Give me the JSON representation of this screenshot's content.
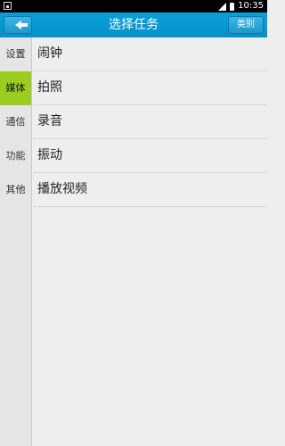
{
  "status_bar": {
    "time": "10:35"
  },
  "header": {
    "title": "选择任务",
    "category_label": "类别"
  },
  "sidebar": {
    "items": [
      {
        "label": "设置",
        "active": false
      },
      {
        "label": "媒体",
        "active": true
      },
      {
        "label": "通信",
        "active": false
      },
      {
        "label": "功能",
        "active": false
      },
      {
        "label": "其他",
        "active": false
      }
    ]
  },
  "tasks": [
    {
      "label": "闹钟"
    },
    {
      "label": "拍照"
    },
    {
      "label": "录音"
    },
    {
      "label": "振动"
    },
    {
      "label": "播放视频"
    }
  ],
  "colors": {
    "header": "#0aa0d8",
    "active_tab": "#9acd1e",
    "status_bar": "#000000"
  }
}
